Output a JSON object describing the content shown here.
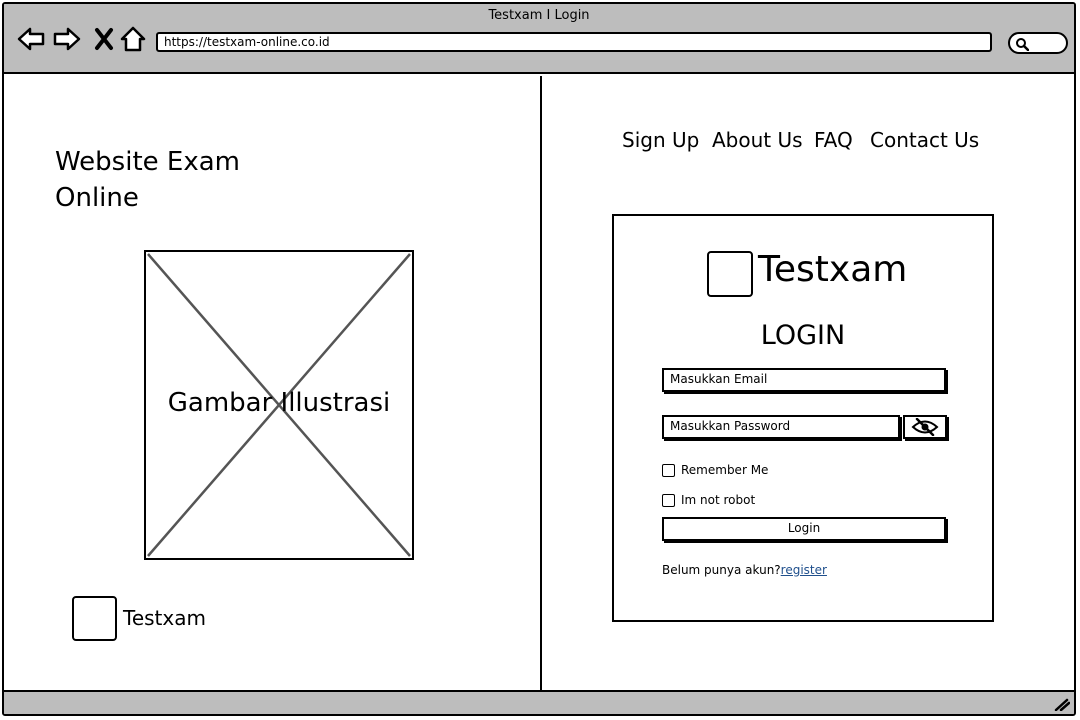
{
  "window": {
    "title": "Testxam I Login"
  },
  "browser": {
    "url": "https://testxam-online.co.id",
    "buttons": [
      {
        "name": "back-arrow-icon"
      },
      {
        "name": "forward-arrow-icon"
      },
      {
        "name": "close-x-icon"
      },
      {
        "name": "home-icon"
      }
    ]
  },
  "left": {
    "site_title_line1": "Website Exam",
    "site_title_line2": "Online",
    "illustration_label": "Gambar Illustrasi",
    "footer_brand": "Testxam"
  },
  "nav": {
    "items": [
      "Sign Up",
      "About Us",
      "FAQ",
      "Contact Us"
    ]
  },
  "login": {
    "brand": "Testxam",
    "heading": "LOGIN",
    "email_placeholder": "Masukkan Email",
    "password_placeholder": "Masukkan Password",
    "remember_label": "Remember Me",
    "robot_label": "Im not robot",
    "submit_label": "Login",
    "register_prompt": "Belum punya akun?",
    "register_link": "register"
  },
  "colors": {
    "chrome": "#bdbdbd",
    "link": "#1f4f8c"
  }
}
